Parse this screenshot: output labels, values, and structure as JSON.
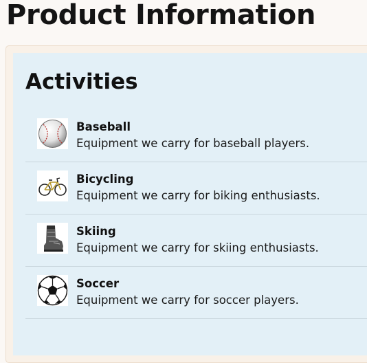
{
  "page": {
    "title": "Product Information"
  },
  "section": {
    "title": "Activities"
  },
  "activities": [
    {
      "name": "Baseball",
      "description": "Equipment we carry for baseball players.",
      "icon": "baseball-icon"
    },
    {
      "name": "Bicycling",
      "description": "Equipment we carry for biking enthusiasts.",
      "icon": "bicycle-icon"
    },
    {
      "name": "Skiing",
      "description": "Equipment we carry for skiing enthusiasts.",
      "icon": "ski-boot-icon"
    },
    {
      "name": "Soccer",
      "description": "Equipment we carry for soccer players.",
      "icon": "soccer-ball-icon"
    }
  ],
  "colors": {
    "page_background": "#fbf8f5",
    "panel_border": "#ecdccb",
    "panel_background": "#e3f0f7",
    "divider": "#c9d6dd",
    "text": "#111111"
  }
}
